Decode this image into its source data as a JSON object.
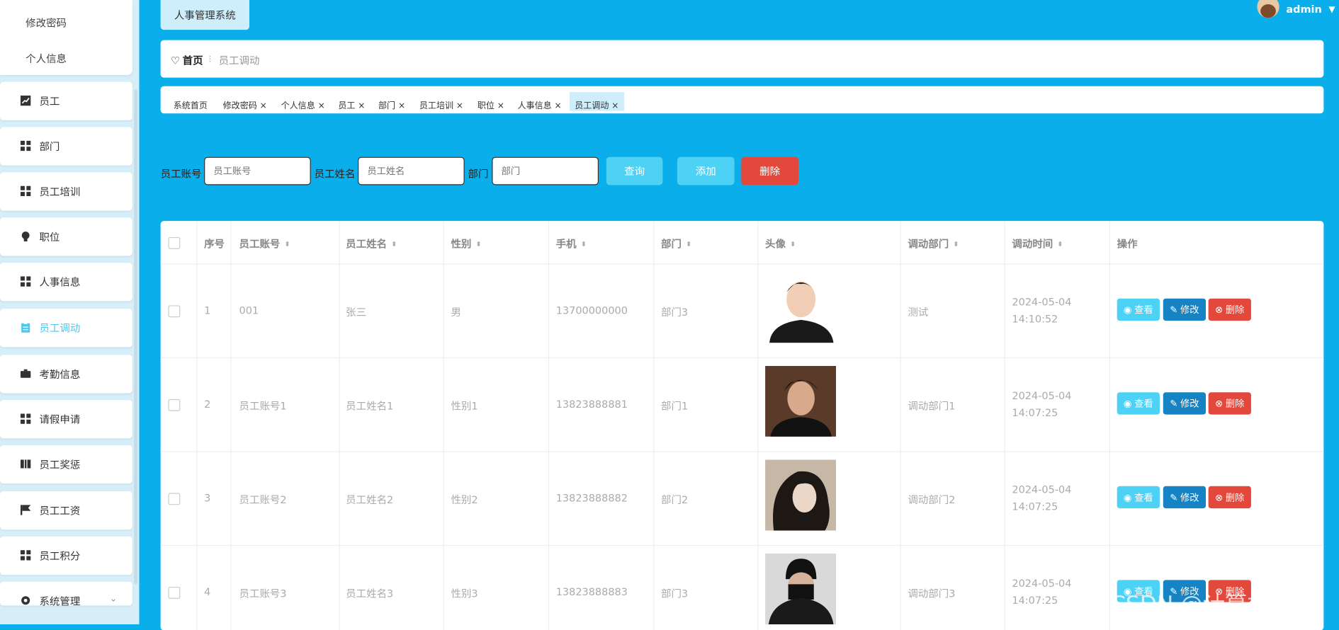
{
  "app": {
    "title": "人事管理系统",
    "user": "admin"
  },
  "sidebar": {
    "sub_items": [
      "修改密码",
      "个人信息"
    ],
    "items": [
      {
        "label": "员工",
        "icon": "chart-icon"
      },
      {
        "label": "部门",
        "icon": "grid-icon"
      },
      {
        "label": "员工培训",
        "icon": "grid-icon"
      },
      {
        "label": "职位",
        "icon": "bulb-icon"
      },
      {
        "label": "人事信息",
        "icon": "grid-icon"
      },
      {
        "label": "员工调动",
        "icon": "clipboard-icon",
        "active": true
      },
      {
        "label": "考勤信息",
        "icon": "briefcase-icon"
      },
      {
        "label": "请假申请",
        "icon": "grid-icon"
      },
      {
        "label": "员工奖惩",
        "icon": "book-icon"
      },
      {
        "label": "员工工资",
        "icon": "flag-icon"
      },
      {
        "label": "员工积分",
        "icon": "grid-icon"
      },
      {
        "label": "系统管理",
        "icon": "cog-icon"
      }
    ]
  },
  "breadcrumb": {
    "home": "首页",
    "separator": "⁝",
    "current": "员工调动"
  },
  "tabs": [
    "系统首页",
    "修改密码",
    "个人信息",
    "员工",
    "部门",
    "员工培训",
    "职位",
    "人事信息",
    "员工调动"
  ],
  "search": {
    "account_label": "员工账号",
    "account_placeholder": "员工账号",
    "name_label": "员工姓名",
    "name_placeholder": "员工姓名",
    "dept_label": "部门",
    "dept_placeholder": "部门",
    "query": "查询",
    "add": "添加",
    "delete": "删除"
  },
  "table": {
    "headers": [
      "序号",
      "员工账号",
      "员工姓名",
      "性别",
      "手机",
      "部门",
      "头像",
      "调动部门",
      "调动时间",
      "操作"
    ],
    "rows": [
      {
        "no": "1",
        "account": "001",
        "name": "张三",
        "gender": "男",
        "phone": "13700000000",
        "dept": "部门3",
        "target": "测试",
        "time": "2024-05-04 14:10:52"
      },
      {
        "no": "2",
        "account": "员工账号1",
        "name": "员工姓名1",
        "gender": "性别1",
        "phone": "13823888881",
        "dept": "部门1",
        "target": "调动部门1",
        "time": "2024-05-04 14:07:25"
      },
      {
        "no": "3",
        "account": "员工账号2",
        "name": "员工姓名2",
        "gender": "性别2",
        "phone": "13823888882",
        "dept": "部门2",
        "target": "调动部门2",
        "time": "2024-05-04 14:07:25"
      },
      {
        "no": "4",
        "account": "员工账号3",
        "name": "员工姓名3",
        "gender": "性别3",
        "phone": "13823888883",
        "dept": "部门3",
        "target": "调动部门3",
        "time": "2024-05-04 14:07:25"
      }
    ],
    "actions": {
      "view": "查看",
      "edit": "修改",
      "delete": "删除"
    }
  },
  "watermark": "CSDN @计算机学姐",
  "colors": {
    "accent": "#0aaeea",
    "view": "#4dd2f5",
    "edit": "#1684c4",
    "danger": "#e2483b"
  }
}
